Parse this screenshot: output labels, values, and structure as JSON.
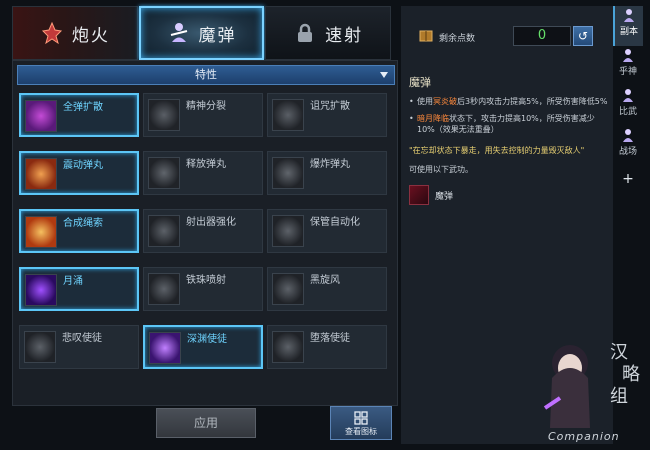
{
  "tabs": [
    {
      "label": "炮火",
      "icon": "fire-crest-icon",
      "active": false
    },
    {
      "label": "魔弹",
      "icon": "magic-bullet-icon",
      "active": true
    },
    {
      "label": "速射",
      "icon": "lock-icon",
      "active": false
    }
  ],
  "panel": {
    "dropdown_label": "特性",
    "apply_label": "应用",
    "view_icons_label": "查看图标"
  },
  "skills": [
    {
      "name": "全弹扩散",
      "selected": true
    },
    {
      "name": "精神分裂",
      "selected": false
    },
    {
      "name": "诅咒扩散",
      "selected": false
    },
    {
      "name": "震动弹丸",
      "selected": true
    },
    {
      "name": "释放弹丸",
      "selected": false
    },
    {
      "name": "爆炸弹丸",
      "selected": false
    },
    {
      "name": "合成绳索",
      "selected": true
    },
    {
      "name": "射出器强化",
      "selected": false
    },
    {
      "name": "保管自动化",
      "selected": false
    },
    {
      "name": "月涌",
      "selected": true
    },
    {
      "name": "铁珠喷射",
      "selected": false
    },
    {
      "name": "黑旋风",
      "selected": false
    },
    {
      "name": "悲叹使徒",
      "selected": false
    },
    {
      "name": "深渊使徒",
      "selected": true
    },
    {
      "name": "堕落使徒",
      "selected": false
    }
  ],
  "points": {
    "label": "剩余点数",
    "value": "0"
  },
  "description": {
    "title": "魔弹",
    "bullet1_a": "使用",
    "bullet1_hl": "冥炎破",
    "bullet1_b": "后3秒内攻击力提高5%，所受伤害降低5%",
    "bullet2_hl": "暗月降临",
    "bullet2_b": "状态下，攻击力提高10%，所受伤害减少10%（效果无法重叠）",
    "quote": "\"在忘却状态下暴走，用失去控制的力量毁灭敌人\"",
    "usable": "可使用以下武功。",
    "weapon": "魔弹"
  },
  "sidebar": [
    {
      "label": "副本",
      "active": true
    },
    {
      "label": "乎神",
      "active": false
    },
    {
      "label": "比武",
      "active": false
    },
    {
      "label": "战场",
      "active": false
    }
  ],
  "sidebar_plus": "+",
  "companion_text": "Companion",
  "colors": {
    "accent": "#5cc6f6",
    "highlight": "#ff8a3c",
    "quote": "#e8d072",
    "points_value": "#66e06a"
  }
}
